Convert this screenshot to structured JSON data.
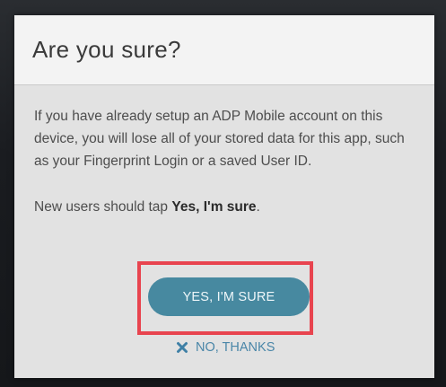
{
  "dialog": {
    "title": "Are you sure?",
    "message": "If you have already setup an ADP Mobile account on this device, you will lose all of your stored data for this app, such as your Fingerprint Login or a saved User ID.",
    "new_users_prefix": "New users should tap ",
    "new_users_emphasis": "Yes, I'm sure",
    "new_users_suffix": ".",
    "confirm_label": "YES, I'M SURE",
    "cancel_label": "NO, THANKS",
    "cancel_icon": "x-icon"
  },
  "colors": {
    "confirm_button": "#4789a0",
    "cancel_link": "#4a86a8",
    "highlight_border": "#e8444f"
  }
}
